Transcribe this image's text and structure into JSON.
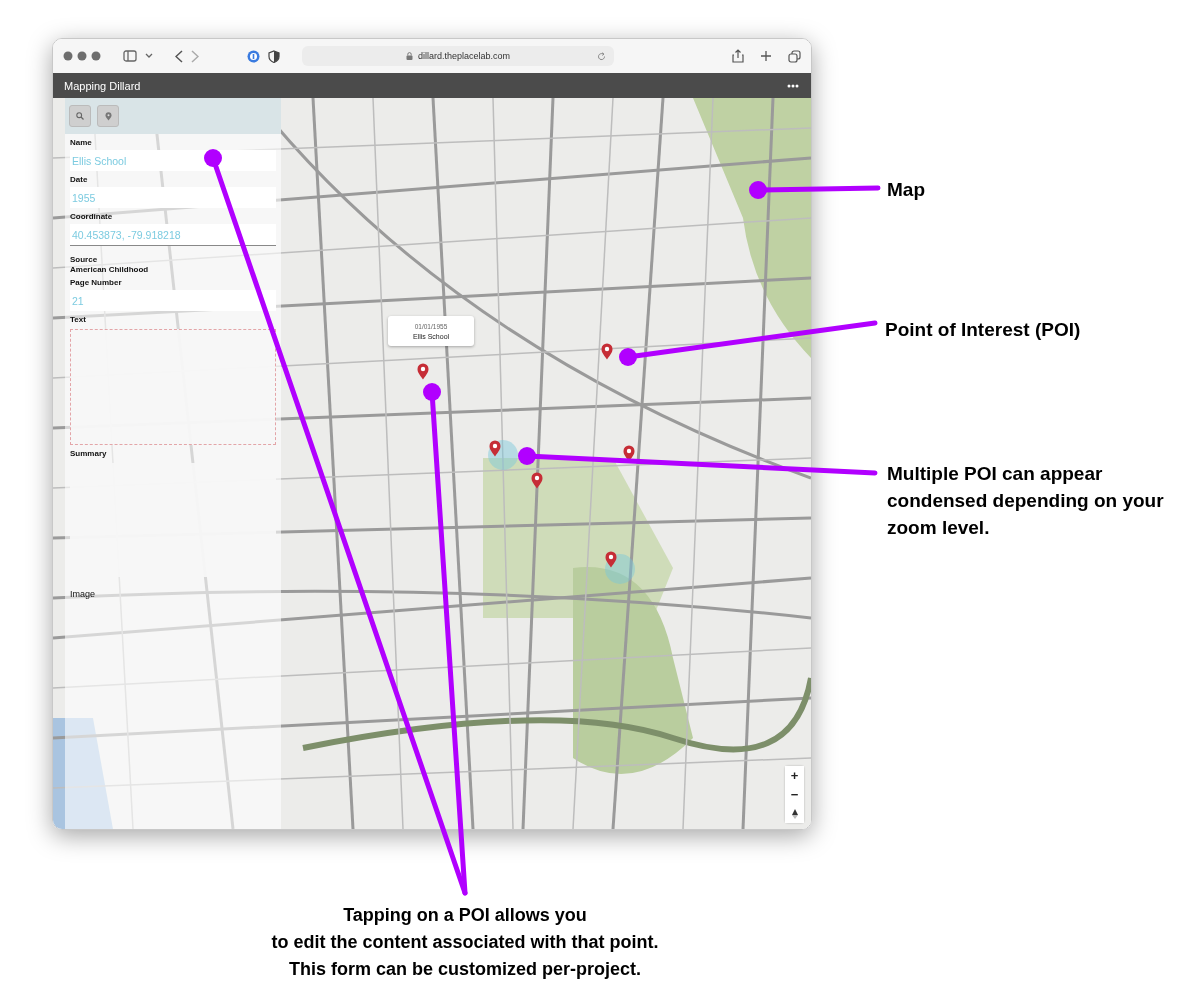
{
  "browser": {
    "url": "dillard.theplacelab.com"
  },
  "app": {
    "title": "Mapping Dillard"
  },
  "form": {
    "fields": [
      {
        "kind": "input",
        "label": "Name",
        "value": "Ellis School"
      },
      {
        "kind": "input",
        "label": "Date",
        "value": "1955"
      },
      {
        "kind": "input",
        "label": "Coordinate",
        "value": "40.453873, -79.918218"
      },
      {
        "kind": "static",
        "label": "Source",
        "value": "American Childhood"
      },
      {
        "kind": "input",
        "label": "Page Number",
        "value": "21"
      },
      {
        "kind": "textarea",
        "label": "Text",
        "focused": true
      },
      {
        "kind": "textarea",
        "label": "Summary",
        "focused": false
      },
      {
        "kind": "plain",
        "label": "Image"
      }
    ]
  },
  "map": {
    "popup": {
      "date": "01/01/1955",
      "name": "Ellis School"
    },
    "zoom_in": "+",
    "zoom_out": "−"
  },
  "annotations": [
    {
      "kind": "side",
      "text": "Map"
    },
    {
      "kind": "side",
      "text": "Point of Interest (POI)"
    },
    {
      "kind": "side",
      "text": "Multiple POI can appear condensed depending on your zoom level."
    },
    {
      "kind": "bottom",
      "lines": [
        "Tapping on a POI allows you",
        "to edit the content associated with that point.",
        "This form can be customized per-project."
      ]
    }
  ]
}
